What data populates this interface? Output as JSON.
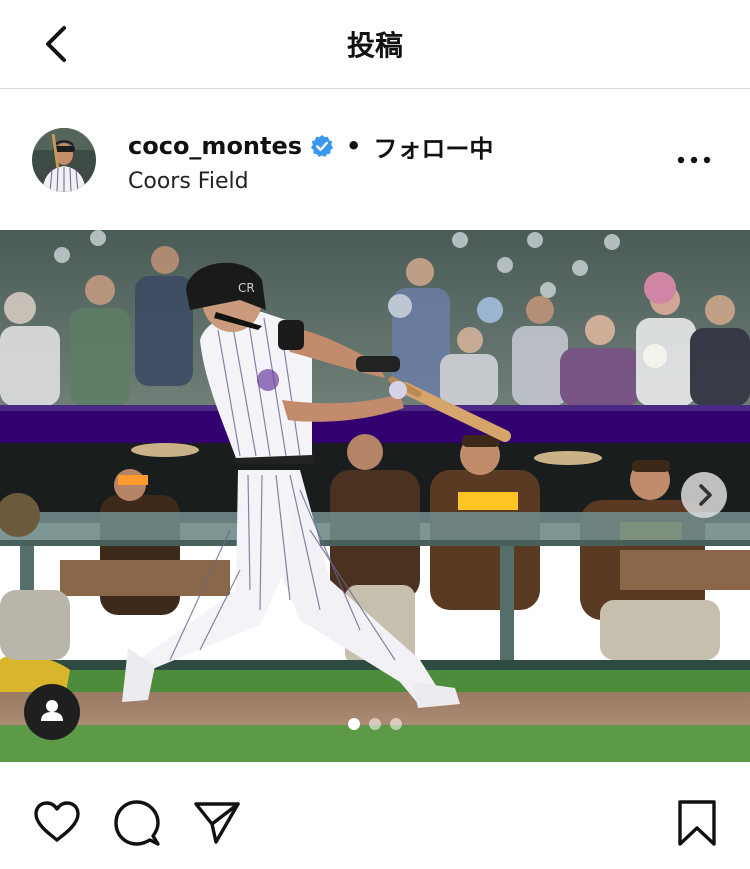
{
  "header": {
    "title": "投稿"
  },
  "post": {
    "username": "coco_montes",
    "separator": "•",
    "follow_status": "フォロー中",
    "location": "Coors Field"
  },
  "carousel": {
    "page_count": 3,
    "active_index": 0
  },
  "colors": {
    "verified_badge": "#3897f0",
    "jersey_pinstripe": "#2b2546",
    "rockies_purple": "#33006f",
    "padres_gold": "#ffc425",
    "padres_brown": "#5a3a22",
    "grass": "#4c8c3b"
  },
  "icons": {
    "back": "chevron-left-icon",
    "verified": "verified-badge-icon",
    "more": "more-horizontal-icon",
    "next": "chevron-right-icon",
    "tags": "person-icon",
    "like": "heart-icon",
    "comment": "comment-icon",
    "share": "paper-plane-icon",
    "save": "bookmark-icon"
  }
}
